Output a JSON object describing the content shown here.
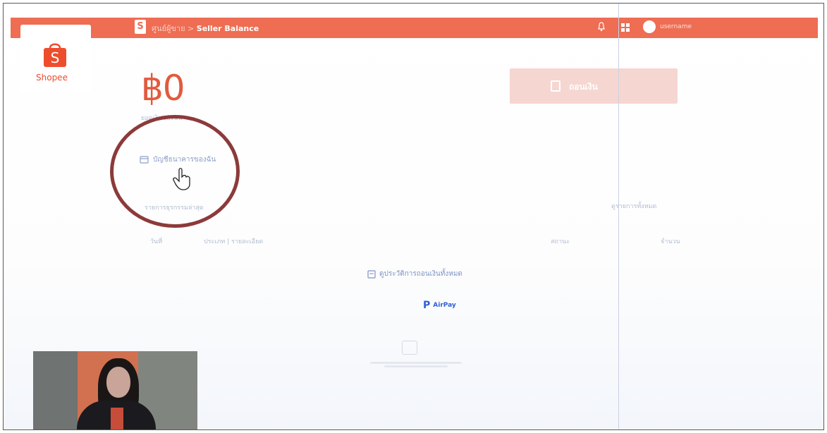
{
  "topbar": {
    "breadcrumb_parent": "ศูนย์ผู้ขาย",
    "breadcrumb_separator": ">",
    "breadcrumb_current": "Seller Balance",
    "user_name": "username"
  },
  "brand": {
    "logo_letter": "S",
    "logo_text": "Shopee",
    "accent_color": "#ee4d2d"
  },
  "balance": {
    "amount": "฿0",
    "label": "ยอดเงินของฉัน"
  },
  "actions": {
    "withdraw_label": "ถอนเงิน",
    "bank_account_link": "บัญชีธนาคารของฉัน",
    "wallet_history_link": "รายการธุรกรรมล่าสุด",
    "view_all_link": "ดูรายการทั้งหมด"
  },
  "table": {
    "columns": [
      "วันที่",
      "ประเภท | รายละเอียด",
      "สถานะ",
      "จำนวน"
    ]
  },
  "empty_state": {
    "link_text": "ดูประวัติการถอนเงินทั้งหมด",
    "airpay_label": "AirPay"
  },
  "overlay": {
    "annotation_color": "#8c3a3a"
  }
}
